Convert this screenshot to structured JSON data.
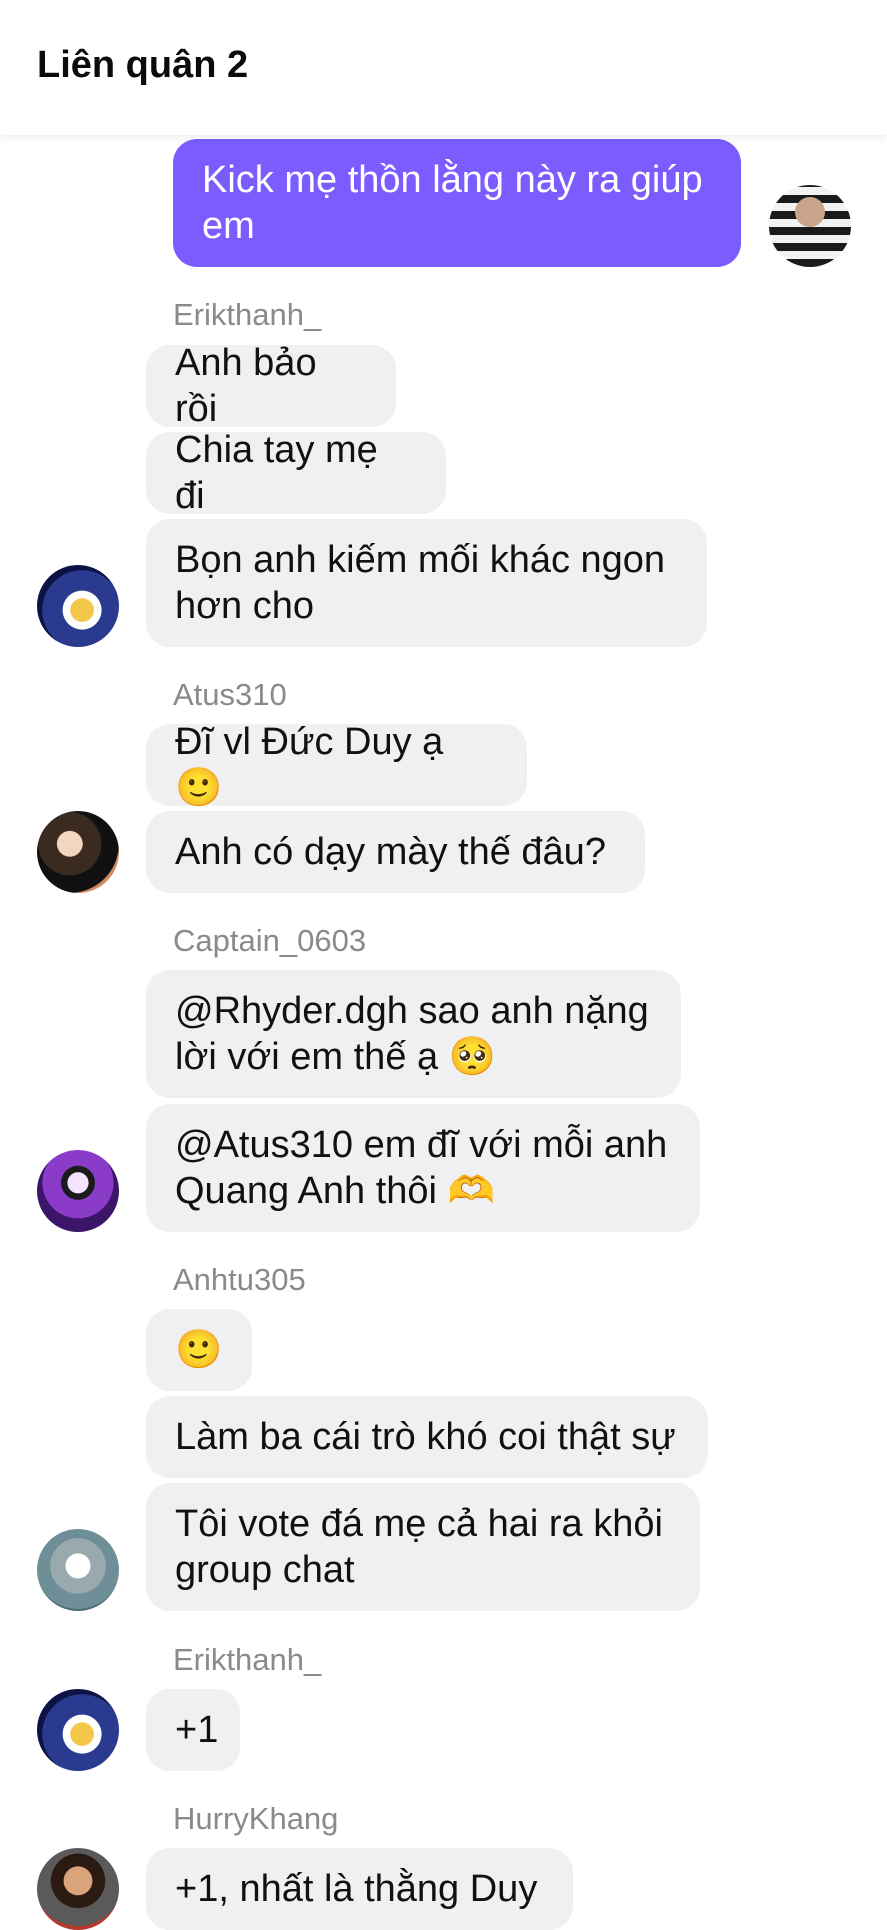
{
  "header": {
    "title": "Liên quân 2"
  },
  "messages": {
    "m0": "Kick mẹ thồn lằng này ra giúp em",
    "g1": {
      "sender": "Erikthanh_",
      "b1": "Anh bảo rồi",
      "b2": "Chia tay mẹ đi",
      "b3": "Bọn anh kiếm mối khác ngon hơn cho"
    },
    "g2": {
      "sender": "Atus310",
      "b1": "Đĩ vl Đức Duy ạ 🙂",
      "b2": "Anh có dạy mày thế đâu?"
    },
    "g3": {
      "sender": "Captain_0603",
      "b1": "@Rhyder.dgh sao anh nặng lời với em thế ạ 🥺",
      "b2": "@Atus310 em đĩ với mỗi anh Quang Anh thôi 🫶"
    },
    "g4": {
      "sender": "Anhtu305",
      "b1": "🙂",
      "b2": "Làm ba cái trò khó coi thật sự",
      "b3": "Tôi vote đá mẹ cả hai ra khỏi group chat"
    },
    "g5": {
      "sender": "Erikthanh_",
      "b1": "+1"
    },
    "g6": {
      "sender": "HurryKhang",
      "b1": "+1, nhất là thằng Duy"
    }
  },
  "colors": {
    "outgoing_bubble": "#7b5cff",
    "incoming_bubble": "#f0f0f2",
    "sender_name": "#8a8a8e"
  },
  "icons": {
    "avatars": [
      "avatar-erikthanh",
      "avatar-atus310",
      "avatar-captain0603",
      "avatar-anhtu305",
      "avatar-hurrykhang",
      "avatar-self"
    ]
  }
}
